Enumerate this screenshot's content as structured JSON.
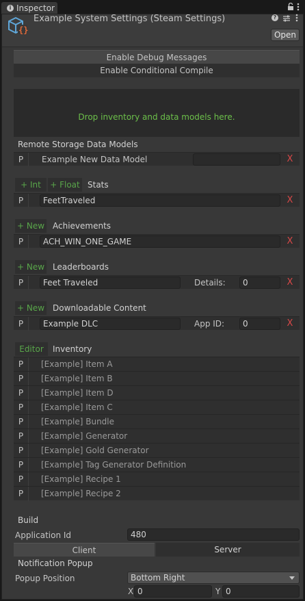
{
  "window": {
    "tab_label": "Inspector",
    "title": "Example System Settings (Steam Settings)",
    "open_button": "Open"
  },
  "toolbar": {
    "debug_label": "Enable Debug Messages",
    "compile_label": "Enable Conditional Compile",
    "drop_text": "Drop inventory and data models here."
  },
  "remote_storage": {
    "heading": "Remote Storage Data Models",
    "rows": [
      {
        "p": "P",
        "name": "Example New Data Model",
        "value": "",
        "remove": "X"
      }
    ]
  },
  "stats": {
    "add_int": "+ Int",
    "add_float": "+ Float",
    "heading": "Stats",
    "rows": [
      {
        "p": "P",
        "name": "FeetTraveled",
        "remove": "X"
      }
    ]
  },
  "achievements": {
    "add_new": "+ New",
    "heading": "Achievements",
    "rows": [
      {
        "p": "P",
        "name": "ACH_WIN_ONE_GAME",
        "remove": "X"
      }
    ]
  },
  "leaderboards": {
    "add_new": "+ New",
    "heading": "Leaderboards",
    "rows": [
      {
        "p": "P",
        "name": "Feet Traveled",
        "details_label": "Details:",
        "details_value": "0",
        "remove": "X"
      }
    ]
  },
  "dlc": {
    "add_new": "+ New",
    "heading": "Downloadable Content",
    "rows": [
      {
        "p": "P",
        "name": "Example DLC",
        "appid_label": "App ID:",
        "appid_value": "0",
        "remove": "X"
      }
    ]
  },
  "inventory": {
    "editor_label": "Editor",
    "heading": "Inventory",
    "items": [
      {
        "p": "P",
        "name": "[Example] Item A"
      },
      {
        "p": "P",
        "name": "[Example] Item B"
      },
      {
        "p": "P",
        "name": "[Example] Item D"
      },
      {
        "p": "P",
        "name": "[Example] Item C"
      },
      {
        "p": "P",
        "name": "[Example] Bundle"
      },
      {
        "p": "P",
        "name": "[Example] Generator"
      },
      {
        "p": "P",
        "name": "[Example] Gold Generator"
      },
      {
        "p": "P",
        "name": "[Example] Tag Generator Definition"
      },
      {
        "p": "P",
        "name": "[Example] Recipe 1"
      },
      {
        "p": "P",
        "name": "[Example] Recipe 2"
      }
    ]
  },
  "build": {
    "heading": "Build",
    "app_id_label": "Application Id",
    "app_id_value": "480",
    "client_label": "Client",
    "server_label": "Server"
  },
  "notification": {
    "heading": "Notification Popup",
    "position_label": "Popup Position",
    "position_value": "Bottom Right",
    "x_label": "X",
    "x_value": "0",
    "y_label": "Y",
    "y_value": "0"
  },
  "colors": {
    "green": "#59a64a",
    "remove_red": "#d84848",
    "panel": "#383838"
  }
}
